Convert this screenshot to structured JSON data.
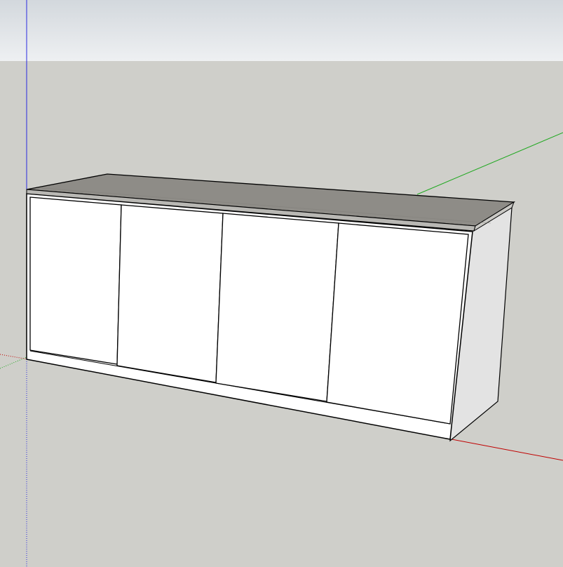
{
  "app": {
    "viewport_label": ""
  },
  "colors": {
    "sky_top": "#d3d8dd",
    "sky_bottom": "#eef0f2",
    "ground": "#cfcfca",
    "countertop": "#8e8c87",
    "countertop_edge": "#b9b8b4",
    "cabinet_front": "#ffffff",
    "cabinet_side": "#e3e3e3",
    "outline": "#000000",
    "axis_red": "#c00000",
    "axis_green": "#1fa81f",
    "axis_blue": "#2a2ae0"
  },
  "model": {
    "object": "cabinet",
    "door_count": 4
  }
}
